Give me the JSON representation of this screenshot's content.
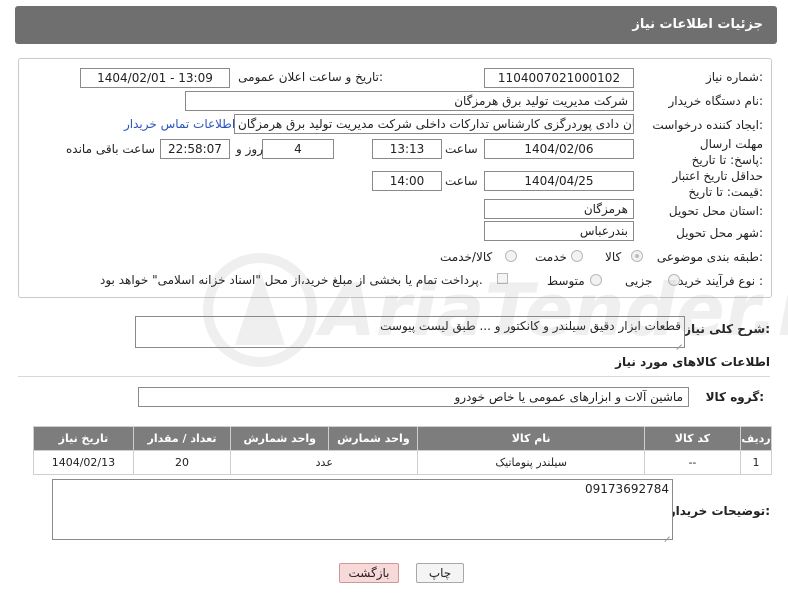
{
  "header": {
    "title": "جزئیات اطلاعات نیاز"
  },
  "form": {
    "need_number_label": "شماره نیاز:",
    "need_number": "1104007021000102",
    "announce_label": "تاریخ و ساعت اعلان عمومی:",
    "announce_value": "1404/02/01 - 13:09",
    "buyer_label": "نام دستگاه خریدار:",
    "buyer_value": "شرکت مدیریت تولید برق هرمزگان",
    "creator_label": "ایجاد کننده درخواست:",
    "creator_value": "پیمان دادی پوردرگزی کارشناس تدارکات داخلی شرکت مدیریت تولید برق هرمزگان",
    "contact_link": "اطلاعات تماس خریدار",
    "deadline_label": "مهلت ارسال پاسخ: تا تاریخ:",
    "deadline_date": "1404/02/06",
    "time_label": "ساعت",
    "deadline_time": "13:13",
    "days_value": "4",
    "days_label": "روز و",
    "remaining_time": "22:58:07",
    "remaining_label": "ساعت باقی مانده",
    "validity_label": "حداقل تاریخ اعتبار قیمت: تا تاریخ:",
    "validity_date": "1404/04/25",
    "validity_time_label": "ساعت",
    "validity_time": "14:00",
    "province_label": "استان محل تحویل:",
    "province_value": "هرمزگان",
    "city_label": "شهر محل تحویل:",
    "city_value": "بندرعباس",
    "category_label": "طبقه بندی موضوعی:",
    "category_options": [
      "کالا",
      "خدمت",
      "کالا/خدمت"
    ],
    "category_selected": "کالا",
    "process_label": "نوع فرآیند خرید :",
    "process_options": [
      "جزیی",
      "متوسط"
    ],
    "process_selected": "جزیی",
    "payment_note": "پرداخت تمام یا بخشی از مبلغ خرید،از محل \"اسناد خزانه اسلامی\" خواهد بود."
  },
  "description": {
    "label": "شرح کلی نیاز:",
    "value": "قطعات ابزار دقیق سیلندر و کانکتور  و ... طبق لیست پیوست"
  },
  "goods": {
    "section_title": "اطلاعات کالاهای مورد نیاز",
    "group_label": "گروه کالا:",
    "group_value": "ماشین آلات و ابزارهای عمومی یا خاص خودرو",
    "columns": [
      "ردیف",
      "کد کالا",
      "نام کالا",
      "واحد شمارش",
      "تعداد / مقدار",
      "تاریخ نیاز"
    ],
    "rows": [
      {
        "row": "1",
        "code": "--",
        "name": "سیلندر پنوماتیک",
        "unit": "عدد",
        "qty": "20",
        "date": "1404/02/13"
      }
    ]
  },
  "buyer_notes": {
    "label": "توضیحات خریدار:",
    "value": "09173692784"
  },
  "buttons": {
    "print": "چاپ",
    "back": "بازگشت"
  },
  "watermark": {
    "text": "AriaTender.net"
  },
  "colors": {
    "header": "#6f6f6f",
    "table_header": "#7d7d7d",
    "link": "#2a55b8",
    "back_button": "#f8d9da"
  }
}
